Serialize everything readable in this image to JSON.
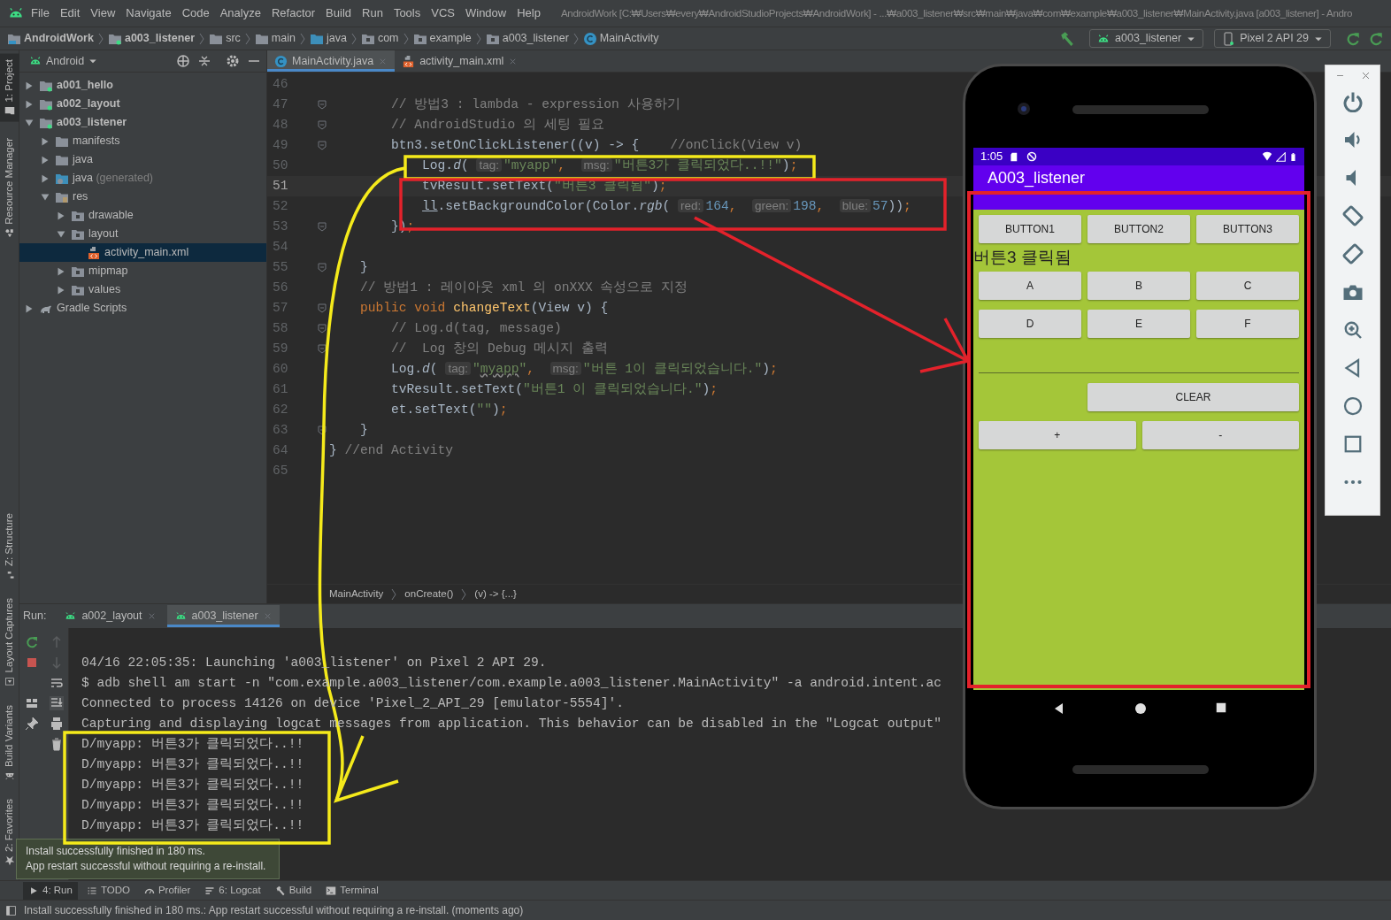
{
  "menu_bar": {
    "items": [
      "File",
      "Edit",
      "View",
      "Navigate",
      "Code",
      "Analyze",
      "Refactor",
      "Build",
      "Run",
      "Tools",
      "VCS",
      "Window",
      "Help"
    ],
    "title": "AndroidWork [C:₩Users₩every₩AndroidStudioProjects₩AndroidWork] - ...₩a003_listener₩src₩main₩java₩com₩example₩a003_listener₩MainActivity.java [a003_listener] - Andro"
  },
  "nav_bar": {
    "breadcrumbs": [
      {
        "label": "AndroidWork",
        "kind": "project"
      },
      {
        "label": "a003_listener",
        "kind": "module"
      },
      {
        "label": "src",
        "kind": "folder"
      },
      {
        "label": "main",
        "kind": "folder"
      },
      {
        "label": "java",
        "kind": "src"
      },
      {
        "label": "com",
        "kind": "package"
      },
      {
        "label": "example",
        "kind": "package"
      },
      {
        "label": "a003_listener",
        "kind": "package"
      },
      {
        "label": "MainActivity",
        "kind": "class"
      }
    ],
    "run_config": "a003_listener",
    "device": "Pixel 2 API 29"
  },
  "side_tabs": [
    {
      "label": "1: Project",
      "kind": "project",
      "selected": true
    },
    {
      "label": "Resource Manager",
      "kind": "resource",
      "selected": false
    },
    {
      "label": "Z: Structure",
      "kind": "structure",
      "selected": false
    },
    {
      "label": "Layout Captures",
      "kind": "captures",
      "selected": false
    },
    {
      "label": "Build Variants",
      "kind": "variants",
      "selected": false
    },
    {
      "label": "2: Favorites",
      "kind": "favorites",
      "selected": false
    }
  ],
  "project_panel": {
    "view": "Android",
    "tree": [
      {
        "label": "a001_hello",
        "kind": "module",
        "expanded": false,
        "selected": false
      },
      {
        "label": "a002_layout",
        "kind": "module",
        "expanded": false,
        "selected": false
      },
      {
        "label": "a003_listener",
        "kind": "module",
        "expanded": true,
        "selected": false,
        "children": [
          {
            "label": "manifests",
            "kind": "folder",
            "expanded": false,
            "selected": false
          },
          {
            "label": "java",
            "kind": "folder",
            "expanded": false,
            "selected": false
          },
          {
            "label": "java",
            "note": "(generated)",
            "kind": "gen-folder",
            "expanded": false,
            "selected": false
          },
          {
            "label": "res",
            "kind": "res-folder",
            "expanded": true,
            "selected": false,
            "children": [
              {
                "label": "drawable",
                "kind": "res-dir",
                "expanded": false,
                "selected": false
              },
              {
                "label": "layout",
                "kind": "res-dir",
                "expanded": true,
                "selected": false,
                "children": [
                  {
                    "label": "activity_main.xml",
                    "kind": "xml",
                    "selected": true
                  }
                ]
              },
              {
                "label": "mipmap",
                "kind": "res-dir",
                "expanded": false,
                "selected": false
              },
              {
                "label": "values",
                "kind": "res-dir",
                "expanded": false,
                "selected": false
              }
            ]
          }
        ]
      },
      {
        "label": "Gradle Scripts",
        "kind": "gradle",
        "expanded": false,
        "selected": false
      }
    ]
  },
  "editor": {
    "tabs": [
      {
        "label": "MainActivity.java",
        "kind": "java",
        "selected": true
      },
      {
        "label": "activity_main.xml",
        "kind": "xml",
        "selected": false
      }
    ],
    "lines": [
      {
        "number": "46",
        "fold": false,
        "current": false
      },
      {
        "number": "47",
        "fold": true,
        "current": false,
        "tokens": [
          {
            "kind": "comment",
            "text": "        // 방법3 : lambda - expression 사용하기"
          }
        ]
      },
      {
        "number": "48",
        "fold": true,
        "current": false,
        "tokens": [
          {
            "kind": "comment",
            "text": "        // AndroidStudio 의 세팅 필요"
          }
        ]
      },
      {
        "number": "49",
        "fold": true,
        "current": false,
        "tokens": [
          {
            "kind": "plain",
            "text": "        btn3.setOnClickListener((v) -> {    "
          },
          {
            "kind": "comment",
            "text": "//onClick(View v)"
          }
        ]
      },
      {
        "number": "50",
        "fold": false,
        "current": false,
        "tokens": [
          {
            "kind": "plain",
            "text": "            Log."
          },
          {
            "kind": "static",
            "text": "d"
          },
          {
            "kind": "plain",
            "text": "( "
          },
          {
            "kind": "hint",
            "text": "tag:"
          },
          {
            "kind": "string",
            "text": "\"myapp\""
          },
          {
            "kind": "punct",
            "text": ",  "
          },
          {
            "kind": "hint",
            "text": "msg:"
          },
          {
            "kind": "string",
            "text": "\"버튼3가 클릭되었다..!!\""
          },
          {
            "kind": "plain",
            "text": ")"
          },
          {
            "kind": "punct",
            "text": ";"
          }
        ]
      },
      {
        "number": "51",
        "fold": false,
        "current": true,
        "tokens": [
          {
            "kind": "plain",
            "text": "            tvResult.setText("
          },
          {
            "kind": "string",
            "text": "\"버튼3 클릭됨\""
          },
          {
            "kind": "plain",
            "text": ")"
          },
          {
            "kind": "punct",
            "text": ";"
          }
        ]
      },
      {
        "number": "52",
        "fold": false,
        "current": false,
        "tokens": [
          {
            "kind": "underlined",
            "text": "            ll"
          },
          {
            "kind": "plain",
            "text": ".setBackgroundColor(Color."
          },
          {
            "kind": "static",
            "text": "rgb"
          },
          {
            "kind": "plain",
            "text": "( "
          },
          {
            "kind": "hint",
            "text": "red:"
          },
          {
            "kind": "number",
            "text": "164"
          },
          {
            "kind": "punct",
            "text": ",  "
          },
          {
            "kind": "hint",
            "text": "green:"
          },
          {
            "kind": "number",
            "text": "198"
          },
          {
            "kind": "punct",
            "text": ",  "
          },
          {
            "kind": "hint",
            "text": "blue:"
          },
          {
            "kind": "number",
            "text": "57"
          },
          {
            "kind": "plain",
            "text": "))"
          },
          {
            "kind": "punct",
            "text": ";"
          }
        ]
      },
      {
        "number": "53",
        "fold": true,
        "current": false,
        "tokens": [
          {
            "kind": "plain",
            "text": "        })"
          },
          {
            "kind": "punct",
            "text": ";"
          }
        ]
      },
      {
        "number": "54",
        "fold": false,
        "current": false
      },
      {
        "number": "55",
        "fold": true,
        "current": false,
        "tokens": [
          {
            "kind": "plain",
            "text": "    }"
          }
        ]
      },
      {
        "number": "56",
        "fold": false,
        "current": false,
        "tokens": [
          {
            "kind": "comment",
            "text": "    // 방법1 : 레이아웃 xml 의 onXXX 속성으로 지정"
          }
        ]
      },
      {
        "number": "57",
        "fold": true,
        "current": false,
        "tokens": [
          {
            "kind": "keyword",
            "text": "    public void "
          },
          {
            "kind": "method",
            "text": "changeText"
          },
          {
            "kind": "plain",
            "text": "(View v) {"
          }
        ]
      },
      {
        "number": "58",
        "fold": true,
        "current": false,
        "tokens": [
          {
            "kind": "comment",
            "text": "        // Log.d(tag, message)"
          }
        ]
      },
      {
        "number": "59",
        "fold": true,
        "current": false,
        "tokens": [
          {
            "kind": "comment",
            "text": "        //  Log 창의 Debug 메시지 출력"
          }
        ]
      },
      {
        "number": "60",
        "fold": false,
        "current": false,
        "tokens": [
          {
            "kind": "plain",
            "text": "        Log."
          },
          {
            "kind": "static",
            "text": "d"
          },
          {
            "kind": "plain",
            "text": "( "
          },
          {
            "kind": "hint",
            "text": "tag:"
          },
          {
            "kind": "string",
            "text": "\""
          },
          {
            "kind": "typo",
            "text": "myapp"
          },
          {
            "kind": "string",
            "text": "\""
          },
          {
            "kind": "punct",
            "text": ",  "
          },
          {
            "kind": "hint",
            "text": "msg:"
          },
          {
            "kind": "string",
            "text": "\"버튼 1이 클릭되었습니다.\""
          },
          {
            "kind": "plain",
            "text": ")"
          },
          {
            "kind": "punct",
            "text": ";"
          }
        ]
      },
      {
        "number": "61",
        "fold": false,
        "current": false,
        "tokens": [
          {
            "kind": "plain",
            "text": "        tvResult.setText("
          },
          {
            "kind": "string",
            "text": "\"버튼1 이 클릭되었습니다.\""
          },
          {
            "kind": "plain",
            "text": ")"
          },
          {
            "kind": "punct",
            "text": ";"
          }
        ]
      },
      {
        "number": "62",
        "fold": false,
        "current": false,
        "tokens": [
          {
            "kind": "plain",
            "text": "        et.setText("
          },
          {
            "kind": "string",
            "text": "\"\""
          },
          {
            "kind": "plain",
            "text": ")"
          },
          {
            "kind": "punct",
            "text": ";"
          }
        ]
      },
      {
        "number": "63",
        "fold": true,
        "current": false,
        "tokens": [
          {
            "kind": "plain",
            "text": "    }"
          }
        ]
      },
      {
        "number": "64",
        "fold": false,
        "current": false,
        "tokens": [
          {
            "kind": "plain",
            "text": "} "
          },
          {
            "kind": "comment",
            "text": "//end Activity"
          }
        ]
      },
      {
        "number": "65",
        "fold": false,
        "current": false
      }
    ],
    "breadcrumbs": [
      "MainActivity",
      "onCreate()",
      "(v) -> {...}"
    ]
  },
  "run_panel": {
    "label": "Run:",
    "tabs": [
      {
        "label": "a002_layout",
        "selected": false
      },
      {
        "label": "a003_listener",
        "selected": true
      }
    ],
    "console": [
      "04/16 22:05:35: Launching 'a003_listener' on Pixel 2 API 29.",
      "$ adb shell am start -n \"com.example.a003_listener/com.example.a003_listener.MainActivity\" -a android.intent.ac",
      "Connected to process 14126 on device 'Pixel_2_API_29 [emulator-5554]'.",
      "Capturing and displaying logcat messages from application. This behavior can be disabled in the \"Logcat output\"",
      "D/myapp: 버튼3가 클릭되었다..!!",
      "D/myapp: 버튼3가 클릭되었다..!!",
      "D/myapp: 버튼3가 클릭되었다..!!",
      "D/myapp: 버튼3가 클릭되었다..!!",
      "D/myapp: 버튼3가 클릭되었다..!!"
    ]
  },
  "balloon": [
    "Install successfully finished in 180 ms.",
    "App restart successful without requiring a re-install."
  ],
  "tool_bar": [
    {
      "label": "4: Run",
      "kind": "run",
      "selected": true
    },
    {
      "label": "TODO",
      "kind": "todo",
      "selected": false
    },
    {
      "label": "Profiler",
      "kind": "profiler",
      "selected": false
    },
    {
      "label": "6: Logcat",
      "kind": "logcat",
      "selected": false
    },
    {
      "label": "Build",
      "kind": "build",
      "selected": false
    },
    {
      "label": "Terminal",
      "kind": "terminal",
      "selected": false
    }
  ],
  "status_bar": "Install successfully finished in 180 ms.: App restart successful without requiring a re-install. (moments ago)",
  "emulator": {
    "time": "1:05",
    "app_title": "A003_listener",
    "top_buttons": [
      "BUTTON1",
      "BUTTON2",
      "BUTTON3"
    ],
    "result_text": "버튼3 클릭됨",
    "grid_buttons": [
      "A",
      "B",
      "C",
      "D",
      "E",
      "F"
    ],
    "clear_button": "CLEAR",
    "step_buttons": [
      "+",
      "-"
    ]
  }
}
